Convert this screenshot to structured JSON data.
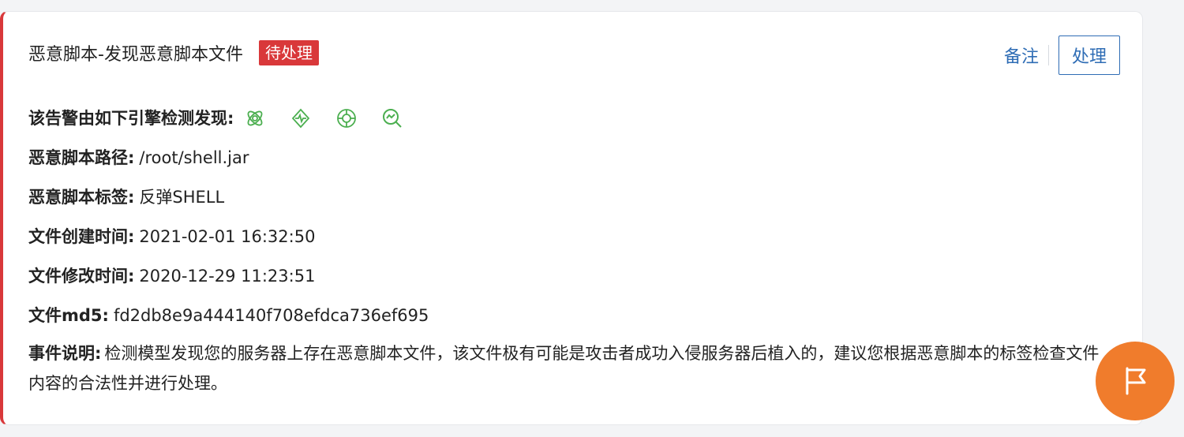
{
  "alert": {
    "title": "恶意脚本-发现恶意脚本文件",
    "status": "待处理",
    "status_color": "#d9383a",
    "actions": {
      "note_label": "备注",
      "process_label": "处理"
    },
    "engines_label": "该告警由如下引擎检测发现:",
    "engine_icons": [
      "atom-icon",
      "pulse-icon",
      "target-icon",
      "analysis-magnifier-icon"
    ],
    "fields": [
      {
        "label": "恶意脚本路径:",
        "value": "/root/shell.jar"
      },
      {
        "label": "恶意脚本标签:",
        "value": "反弹SHELL"
      },
      {
        "label": "文件创建时间:",
        "value": "2021-02-01 16:32:50"
      },
      {
        "label": "文件修改时间:",
        "value": "2020-12-29 11:23:51"
      },
      {
        "label": "文件md5:",
        "value": "fd2db8e9a444140f708efdca736ef695"
      }
    ],
    "description": {
      "label": "事件说明:",
      "text": "检测模型发现您的服务器上存在恶意脚本文件，该文件极有可能是攻击者成功入侵服务器后植入的，建议您根据恶意脚本的标签检查文件内容的合法性并进行处理。"
    }
  },
  "fab": {
    "icon": "flag-icon",
    "color": "#f07c2c"
  },
  "colors": {
    "accent": "#2f6db5",
    "engine_icon": "#4caf50"
  }
}
